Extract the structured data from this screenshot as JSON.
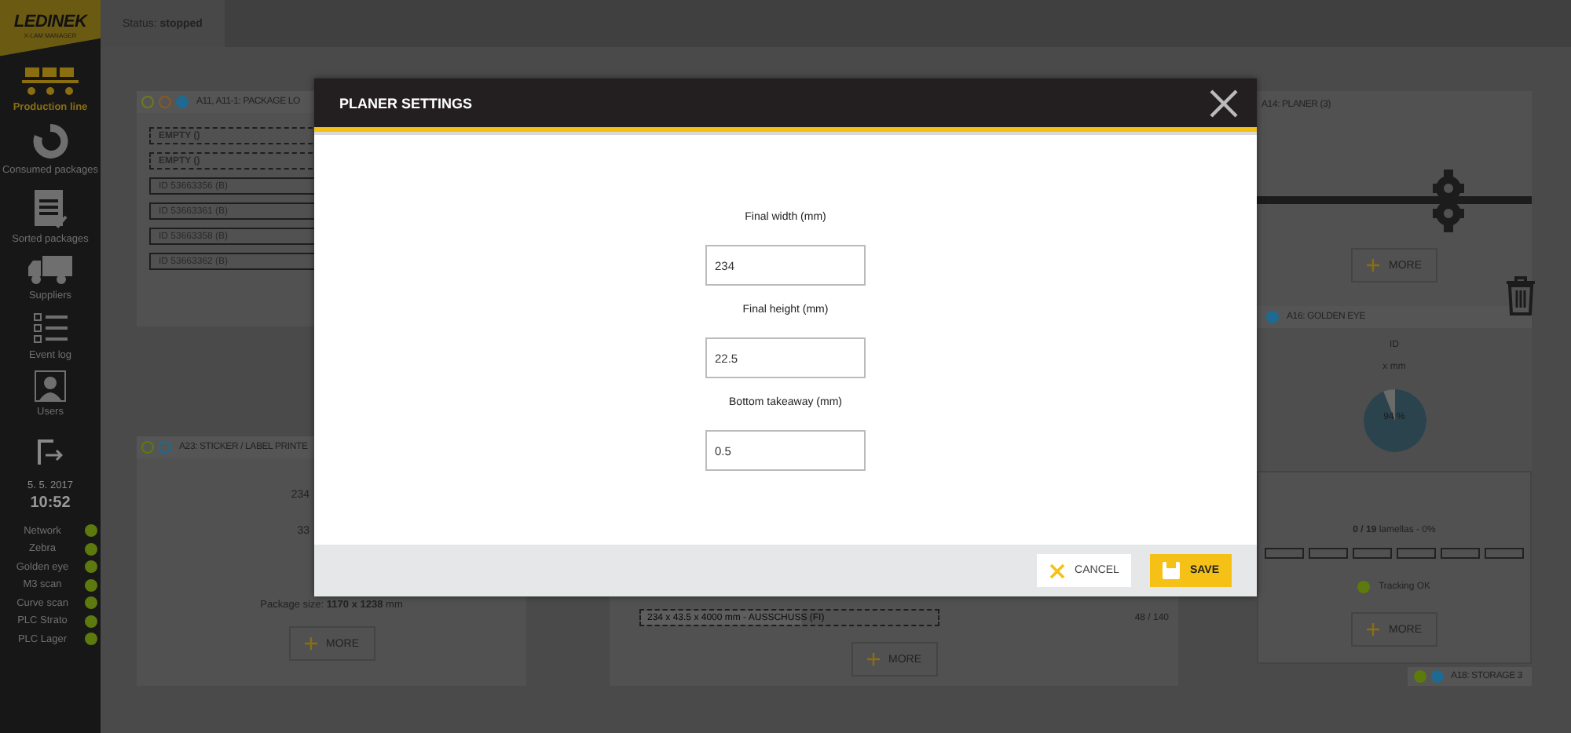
{
  "app": {
    "logo": "LEDINEK",
    "logo_subtitle": "X-LAM MANAGER",
    "status": "Status: **stopped**"
  },
  "sidebar": {
    "items": [
      {
        "label": "Production line",
        "selected": true
      },
      {
        "label": "Consumed packages",
        "selected": false
      },
      {
        "label": "Sorted packages",
        "selected": false
      },
      {
        "label": "Suppliers",
        "selected": false
      },
      {
        "label": "Event log",
        "selected": false
      },
      {
        "label": "Users",
        "selected": false
      }
    ],
    "date": "5. 5. 2017",
    "time": "10:52",
    "indicators": [
      {
        "label": "Network",
        "ok": true
      },
      {
        "label": "Zebra",
        "ok": true
      },
      {
        "label": "Golden eye",
        "ok": true
      },
      {
        "label": "M3 scan",
        "ok": true
      },
      {
        "label": "Curve scan",
        "ok": true
      },
      {
        "label": "PLC Strato",
        "ok": true
      },
      {
        "label": "PLC Lager",
        "ok": true
      }
    ]
  },
  "loader_card": {
    "title": "A11, A11-1: PACKAGE LO",
    "lights": [
      {
        "color": "#6f7a1c",
        "filled": false
      },
      {
        "color": "#8a5a1c",
        "filled": false
      },
      {
        "color": "#1e6a92",
        "filled": true
      }
    ],
    "slots": [
      {
        "label": "EMPTY ()",
        "empty": true
      },
      {
        "label": "EMPTY ()",
        "empty": true
      },
      {
        "label": "ID 53663356 (B)",
        "empty": false
      },
      {
        "label": "ID 53663361 (B)",
        "empty": false
      },
      {
        "label": "ID 53663358 (B)",
        "empty": false
      },
      {
        "label": "ID 53663362 (B)",
        "empty": false
      }
    ]
  },
  "printer_card": {
    "title": "A23: STICKER / LABEL PRINTE",
    "lights": [
      {
        "color": "#5c7a0e",
        "filled": false
      },
      {
        "color": "#1e6a92",
        "filled": false
      }
    ],
    "values": [
      "234",
      "33"
    ],
    "package_size": "Package size: **1170 x 1238** mm",
    "more": "MORE"
  },
  "middle_card": {
    "row": {
      "label": "234 x 43.5 x 4000 mm - AUSSCHUSS (FI)",
      "level": 0.54
    },
    "count": "48 / 140",
    "more": "MORE"
  },
  "planer_card": {
    "title": "A14: PLANER (3)",
    "more": "MORE"
  },
  "golden_eye_card": {
    "title": "A16: GOLDEN EYE",
    "dot": {
      "color": "#1e6a92"
    },
    "id_label": "ID",
    "dims": "x mm",
    "pie": {
      "level": 0.94,
      "label": "94 %"
    }
  },
  "lamella_card": {
    "summary": "**0 / 19** lamellas - 0%",
    "segments": [
      {
        "filled": false
      },
      {
        "filled": false
      },
      {
        "filled": false
      },
      {
        "filled": false
      },
      {
        "filled": false
      },
      {
        "filled": false
      }
    ],
    "tracking": {
      "label": "Tracking OK",
      "ok": true
    },
    "more": "MORE"
  },
  "storage_tag": {
    "lights": [
      {
        "color": "#5c7a0e"
      },
      {
        "color": "#1e6a92"
      }
    ],
    "title": "A18: STORAGE 3"
  },
  "modal": {
    "title": "PLANER SETTINGS",
    "fields": [
      {
        "label": "Final width (mm)",
        "value": "234"
      },
      {
        "label": "Final height (mm)",
        "value": "22.5"
      },
      {
        "label": "Bottom takeaway (mm)",
        "value": "0.5"
      }
    ],
    "buttons": [
      {
        "label": "CANCEL",
        "kind": "cancel"
      },
      {
        "label": "SAVE",
        "kind": "save"
      }
    ]
  }
}
